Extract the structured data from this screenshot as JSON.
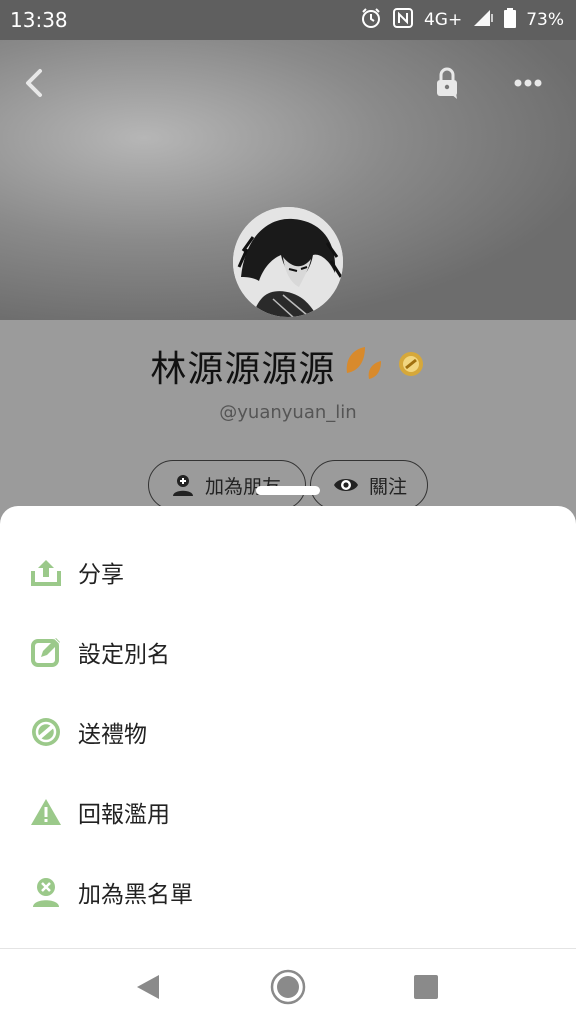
{
  "status_bar": {
    "time": "13:38",
    "network": "4G+",
    "battery": "73%",
    "icons": [
      "alarm-icon",
      "nfc-icon",
      "signal-icon",
      "battery-icon"
    ]
  },
  "header": {
    "back_icon": "back-arrow-icon",
    "lock_icon": "lock-icon",
    "more_icon": "more-dots-icon"
  },
  "profile": {
    "name": "林源源源源",
    "handle": "@yuanyuan_lin"
  },
  "actions": {
    "add_friend": "加為朋友",
    "follow": "關注"
  },
  "menu": {
    "items": [
      {
        "label": "分享",
        "icon": "share-icon"
      },
      {
        "label": "設定別名",
        "icon": "edit-icon"
      },
      {
        "label": "送禮物",
        "icon": "gift-icon"
      },
      {
        "label": "回報濫用",
        "icon": "warning-icon"
      },
      {
        "label": "加為黑名單",
        "icon": "block-user-icon"
      }
    ]
  },
  "colors": {
    "accent": "#9bc98a",
    "overlay": "#9b9b9b",
    "sheet": "#ffffff"
  },
  "nav": {
    "icons": [
      "nav-back-icon",
      "nav-home-icon",
      "nav-recents-icon"
    ]
  }
}
